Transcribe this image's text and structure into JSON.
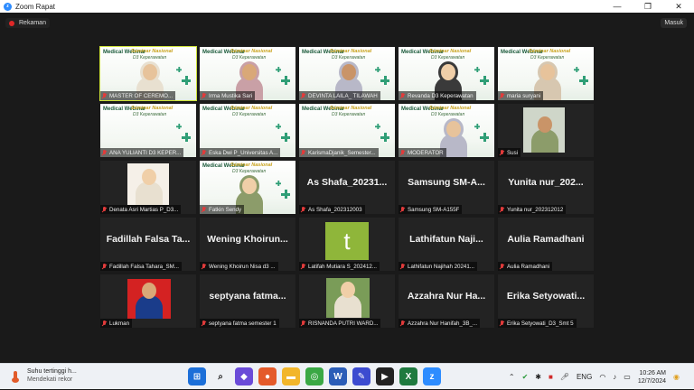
{
  "window": {
    "title": "Zoom Rapat"
  },
  "meeting": {
    "recording_label": "Rekaman",
    "enter_label": "Masuk"
  },
  "tiles": [
    {
      "name": "MASTER OF CEREMO...",
      "type": "poster"
    },
    {
      "name": "Irma Mustika Sari",
      "type": "poster"
    },
    {
      "name": "DEVINTA LAILA_ TILAWAH",
      "type": "poster"
    },
    {
      "name": "Revanda D3 Keperawatan",
      "type": "poster"
    },
    {
      "name": "maria suryani",
      "type": "poster"
    },
    {
      "name": "ANA YULIANTI D3 KEPER...",
      "type": "poster"
    },
    {
      "name": "Eska Dwi P_Universitas A...",
      "type": "poster"
    },
    {
      "name": "KarismaDjanik_Semester...",
      "type": "poster"
    },
    {
      "name": "MODERATOR",
      "type": "poster"
    },
    {
      "name": "Susi",
      "type": "video"
    },
    {
      "name": "Denata Asri Martias P_D3...",
      "type": "video"
    },
    {
      "name": "Fatkin Sendy",
      "type": "poster"
    },
    {
      "name": "As Shafa_202312003",
      "big": "As Shafa_20231...",
      "type": "text"
    },
    {
      "name": "Samsung SM-A155F",
      "big": "Samsung SM-A...",
      "type": "text"
    },
    {
      "name": "Yunita nur_202312012",
      "big": "Yunita nur_202...",
      "type": "text"
    },
    {
      "name": "Fadillah Falsa Tahara_SM...",
      "big": "Fadillah Falsa Ta...",
      "type": "text"
    },
    {
      "name": "Wening Khoirun Nisa d3 ...",
      "big": "Wening Khoirun...",
      "type": "text"
    },
    {
      "name": "Latifah Mutiara S_202412...",
      "type": "avatar",
      "letter": "t"
    },
    {
      "name": "Lathifatun Najihah 20241...",
      "big": "Lathifatun Naji...",
      "type": "text"
    },
    {
      "name": "Aulia Ramadhani",
      "big": "Aulia Ramadhani",
      "type": "text"
    },
    {
      "name": "Lukman",
      "type": "video"
    },
    {
      "name": "septyana fatma semester 1",
      "big": "septyana fatma...",
      "type": "text"
    },
    {
      "name": "RISNANDA PUTRI WARD...",
      "type": "video"
    },
    {
      "name": "Azzahra Nur Hanifah_3B_...",
      "big": "Azzahra Nur Ha...",
      "type": "text"
    },
    {
      "name": "Erika Setyowati_D3_Smt 5",
      "big": "Erika Setyowati...",
      "type": "text"
    }
  ],
  "poster": {
    "title": "Medical Webinar",
    "script": "Seminar Nasional",
    "sub": "D3 Keperawatan"
  },
  "taskbar": {
    "weather_line1": "Suhu tertinggi h...",
    "weather_line2": "Mendekati rekor",
    "lang": "ENG",
    "time": "10:26 AM",
    "date": "12/7/2024"
  },
  "colors": {
    "mic_muted": "#e23b3b",
    "active_speaker": "#cfe33a",
    "avatar_bg": "#8fb63a",
    "zoom_blue": "#2d8cff"
  }
}
